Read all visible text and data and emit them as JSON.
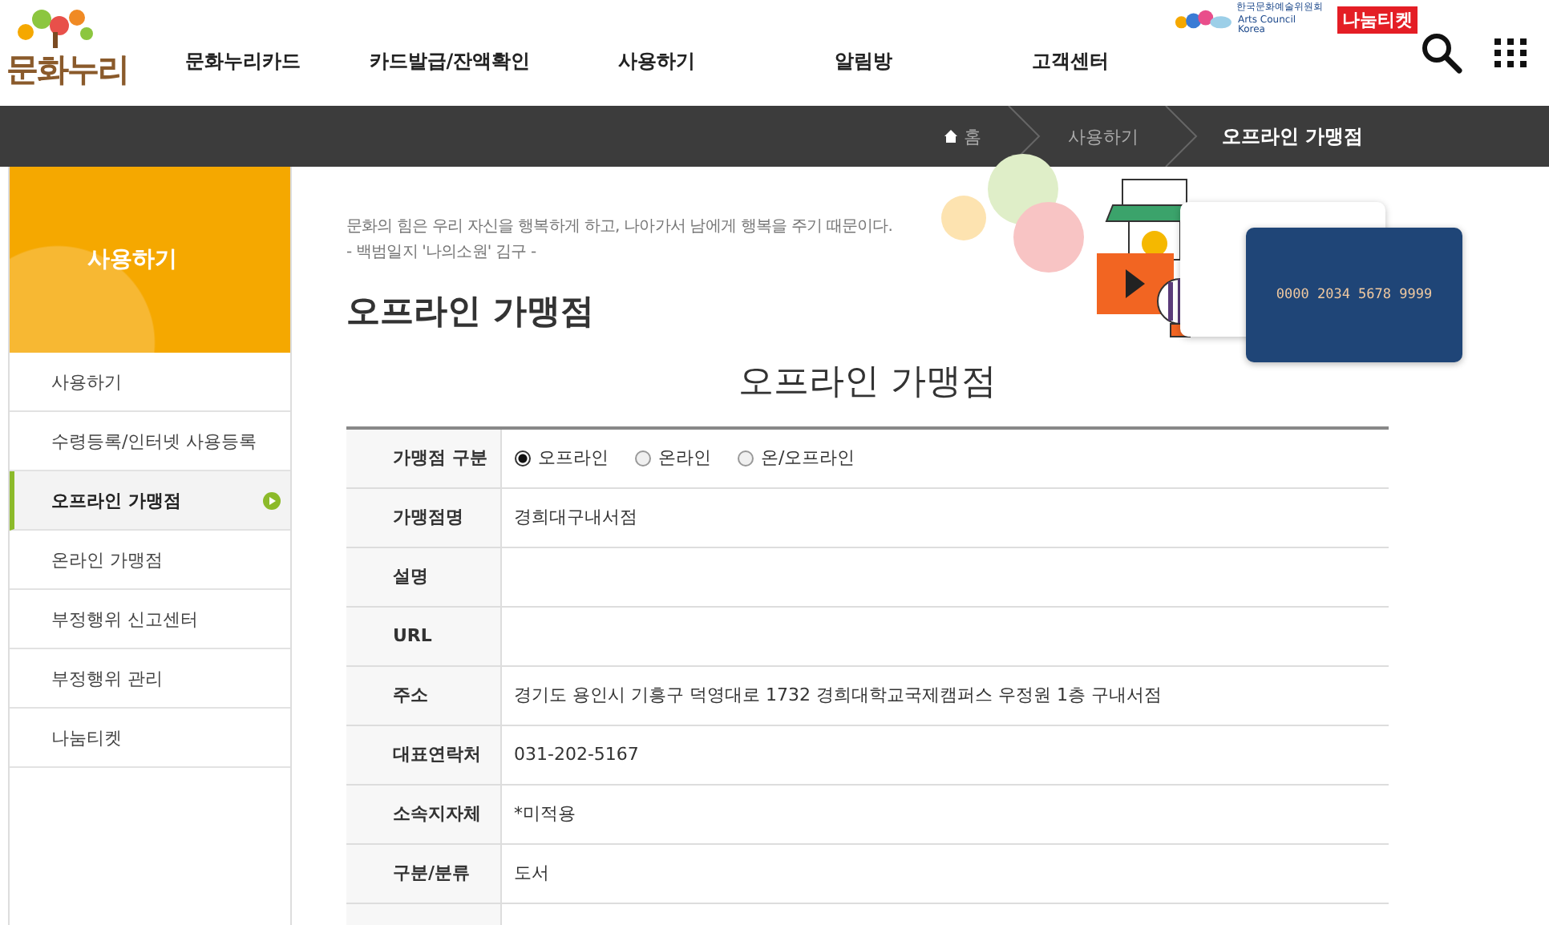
{
  "header": {
    "logo": "문화누리",
    "partner": {
      "name": "한국문화예술위원회",
      "sub": "Arts Council Korea"
    },
    "ticket_logo": "나눔티켓",
    "nav": [
      {
        "label": "문화누리카드",
        "selected": false
      },
      {
        "label": "카드발급/잔액확인",
        "selected": false
      },
      {
        "label": "사용하기",
        "selected": false
      },
      {
        "label": "알림방",
        "selected": false
      },
      {
        "label": "고객센터",
        "selected": false
      }
    ]
  },
  "breadcrumb": [
    {
      "label": "홈",
      "kind": "home"
    },
    {
      "label": "사용하기",
      "kind": "link"
    },
    {
      "label": "오프라인 가맹점",
      "kind": "current"
    }
  ],
  "sidebar": {
    "title": "사용하기",
    "items": [
      {
        "label": "사용하기",
        "selected": false
      },
      {
        "label": "수령등록/인터넷 사용등록",
        "selected": false
      },
      {
        "label": "오프라인 가맹점",
        "selected": true
      },
      {
        "label": "온라인 가맹점",
        "selected": false
      },
      {
        "label": "부정행위 신고센터",
        "selected": false
      },
      {
        "label": "부정행위 관리",
        "selected": false
      },
      {
        "label": "나눔티켓",
        "selected": false
      }
    ]
  },
  "quote": [
    "문화의 힘은 우리 자신을 행복하게 하고, 나아가서 남에게 행복을 주기 때문이다.",
    "- 백범일지 '나의소원' 김구 -"
  ],
  "page_title": "오프라인 가맹점",
  "card_number": "0000 2034 5678 9999",
  "section_title": "오프라인 가맹점",
  "table": {
    "rows": [
      {
        "label": "가맹점 구분",
        "kind": "radio",
        "options": [
          {
            "label": "오프라인",
            "selected": true
          },
          {
            "label": "온라인",
            "selected": false
          },
          {
            "label": "온/오프라인",
            "selected": false
          }
        ]
      },
      {
        "label": "가맹점명",
        "kind": "text",
        "value": "경희대구내서점"
      },
      {
        "label": "설명",
        "kind": "text",
        "value": ""
      },
      {
        "label": "URL",
        "kind": "text",
        "value": ""
      },
      {
        "label": "주소",
        "kind": "text",
        "value": "경기도 용인시 기흥구 덕영대로 1732 경희대학교국제캠퍼스 우정원 1층 구내서점"
      },
      {
        "label": "대표연락처",
        "kind": "text",
        "value": "031-202-5167"
      },
      {
        "label": "소속지자체",
        "kind": "text",
        "value": "*미적용"
      },
      {
        "label": "구분/분류",
        "kind": "text",
        "value": "도서"
      }
    ]
  }
}
